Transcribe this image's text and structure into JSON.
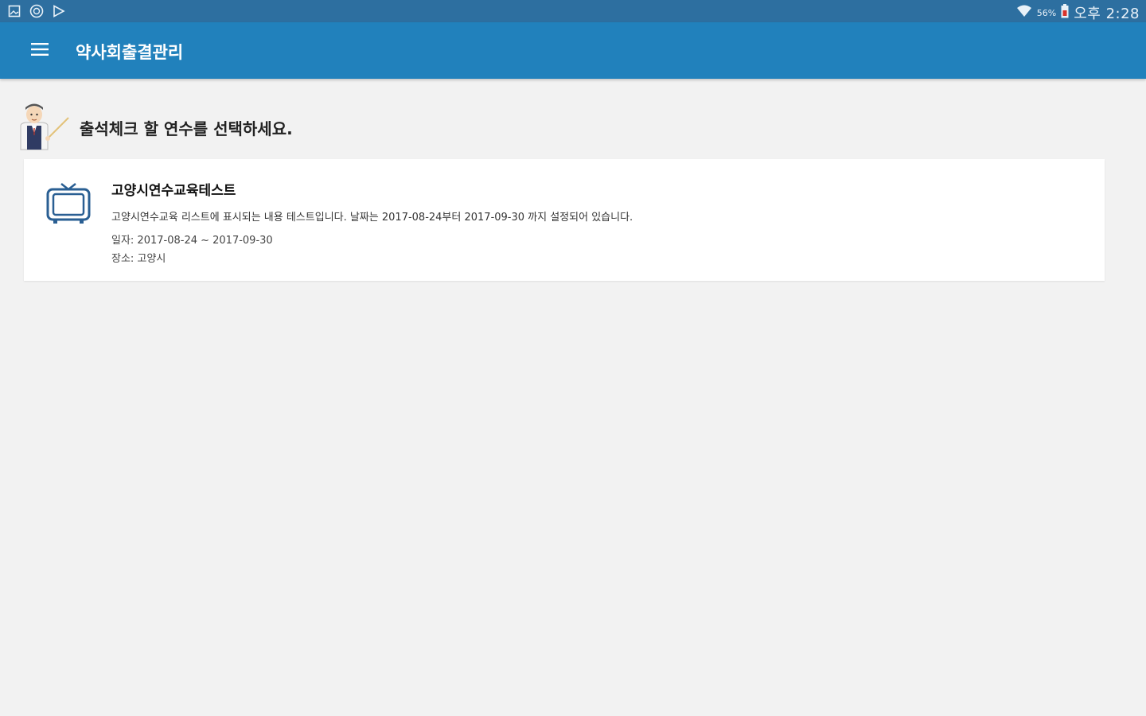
{
  "status_bar": {
    "left_icons": [
      "gallery-icon",
      "sync-icon",
      "play-store-icon"
    ],
    "battery_percent": "56%",
    "time": "오후 2:28"
  },
  "app_bar": {
    "title": "약사회출결관리"
  },
  "prompt": {
    "text": "출석체크 할 연수를 선택하세요."
  },
  "courses": [
    {
      "title": "고양시연수교육테스트",
      "description": "고양시연수교육 리스트에 표시되는 내용 테스트입니다. 날짜는 2017-08-24부터 2017-09-30 까지 설정되어 있습니다.",
      "date": "일자: 2017-08-24 ~ 2017-09-30",
      "place": "장소: 고양시",
      "icon": "tv-icon"
    }
  ],
  "colors": {
    "status_bar": "#2d6fa0",
    "app_bar": "#2181bc",
    "background": "#f2f2f2",
    "icon_blue": "#2a5f93"
  }
}
